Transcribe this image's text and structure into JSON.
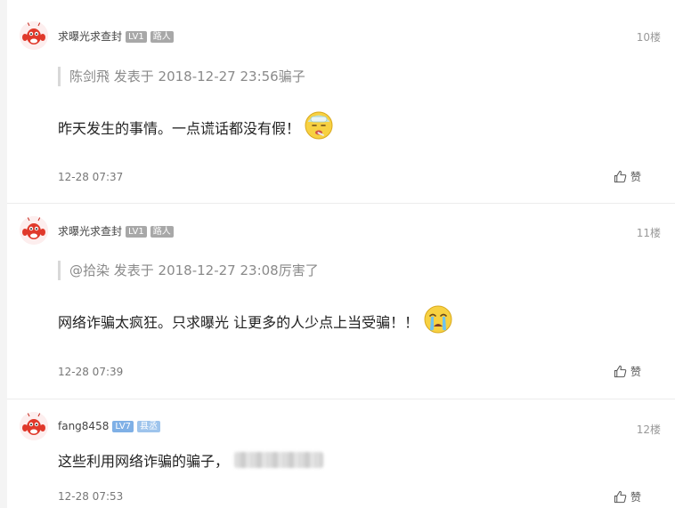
{
  "posts": [
    {
      "username": "求曝光求查封",
      "level": "LV1",
      "role": "路人",
      "floor": "10楼",
      "quote": "陈剑飛 发表于 2018-12-27 23:56骗子",
      "content": "昨天发生的事情。一点谎话都没有假！",
      "emoji": "sick-face-emoji",
      "time": "12-28 07:37",
      "like_label": "赞"
    },
    {
      "username": "求曝光求查封",
      "level": "LV1",
      "role": "路人",
      "floor": "11楼",
      "quote": "@拾染 发表于 2018-12-27 23:08厉害了",
      "content": "网络诈骗太疯狂。只求曝光 让更多的人少点上当受骗！！",
      "emoji": "crying-face-emoji",
      "time": "12-28 07:39",
      "like_label": "赞"
    },
    {
      "username": "fang8458",
      "level": "LV7",
      "role": "县丞",
      "floor": "12楼",
      "content": "这些利用网络诈骗的骗子，",
      "time": "12-28 07:53",
      "like_label": "赞"
    }
  ],
  "colors": {
    "level_gray": "#a8a8a8",
    "level_blue": "#7fb0e6",
    "avatar_red": "#e0392b"
  }
}
